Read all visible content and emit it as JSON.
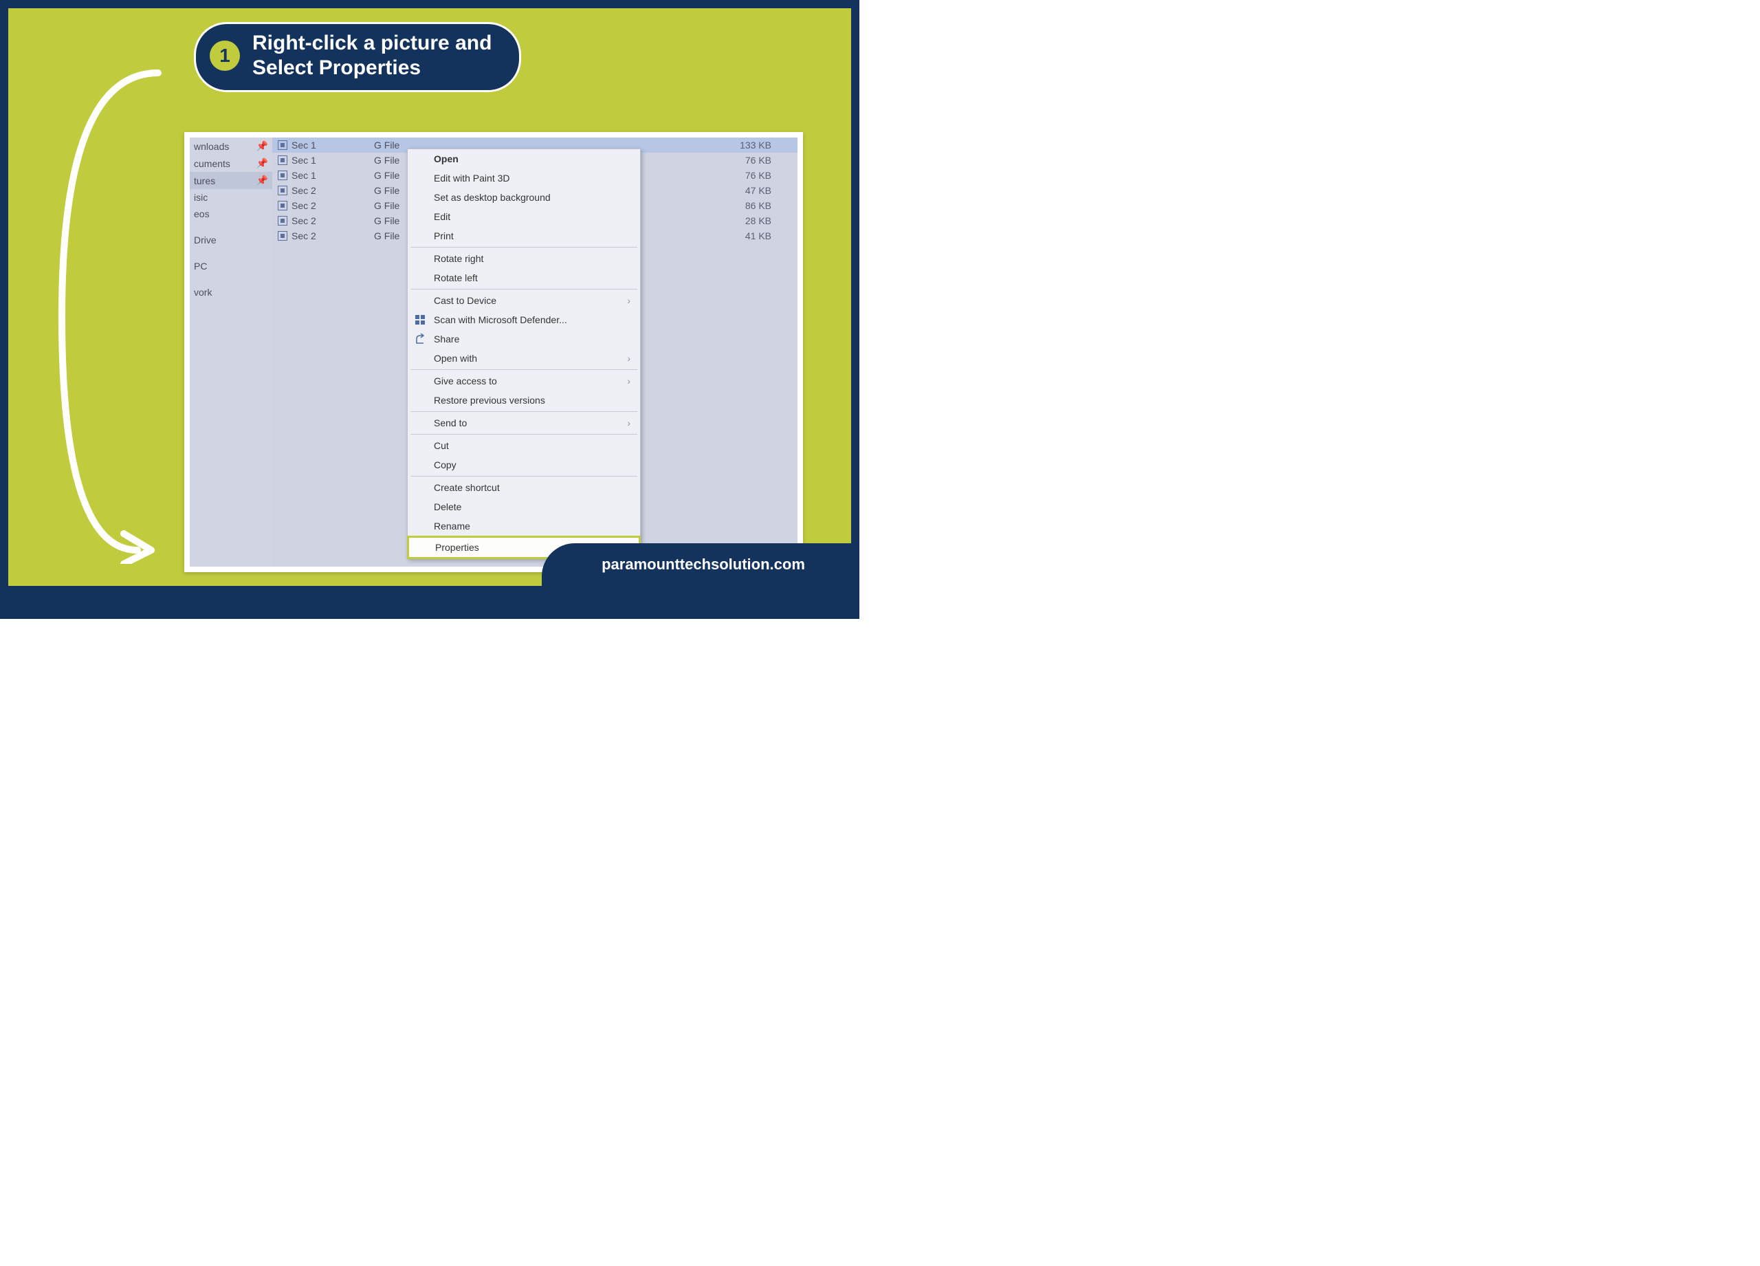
{
  "step": {
    "number": "1",
    "title_line1": "Right-click a picture and",
    "title_line2": "Select Properties"
  },
  "sidebar": {
    "items": [
      {
        "label": "wnloads",
        "pinned": true
      },
      {
        "label": "cuments",
        "pinned": true
      },
      {
        "label": "tures",
        "pinned": true,
        "sel": true
      },
      {
        "label": "isic",
        "pinned": false
      },
      {
        "label": "eos",
        "pinned": false
      },
      {
        "label": "Drive",
        "pinned": false
      },
      {
        "label": "PC",
        "pinned": false
      },
      {
        "label": "vork",
        "pinned": false
      }
    ]
  },
  "files": {
    "rows": [
      {
        "name": "Sec 1",
        "type": "G File",
        "size": "133 KB",
        "sel": true
      },
      {
        "name": "Sec 1",
        "type": "G File",
        "size": "76 KB"
      },
      {
        "name": "Sec 1",
        "type": "G File",
        "size": "76 KB"
      },
      {
        "name": "Sec 2",
        "type": "G File",
        "size": "47 KB"
      },
      {
        "name": "Sec 2",
        "type": "G File",
        "size": "86 KB"
      },
      {
        "name": "Sec 2",
        "type": "G File",
        "size": "28 KB"
      },
      {
        "name": "Sec 2",
        "type": "G File",
        "size": "41 KB"
      }
    ]
  },
  "menu": {
    "open": "Open",
    "editPaint": "Edit with Paint 3D",
    "setBg": "Set as desktop background",
    "edit": "Edit",
    "print": "Print",
    "rotR": "Rotate right",
    "rotL": "Rotate left",
    "cast": "Cast to Device",
    "scan": "Scan with Microsoft Defender...",
    "share": "Share",
    "openWith": "Open with",
    "giveAccess": "Give access to",
    "restore": "Restore previous versions",
    "sendTo": "Send to",
    "cut": "Cut",
    "copy": "Copy",
    "createShortcut": "Create shortcut",
    "delete": "Delete",
    "rename": "Rename",
    "properties": "Properties"
  },
  "footer": {
    "url": "paramounttechsolution.com"
  }
}
